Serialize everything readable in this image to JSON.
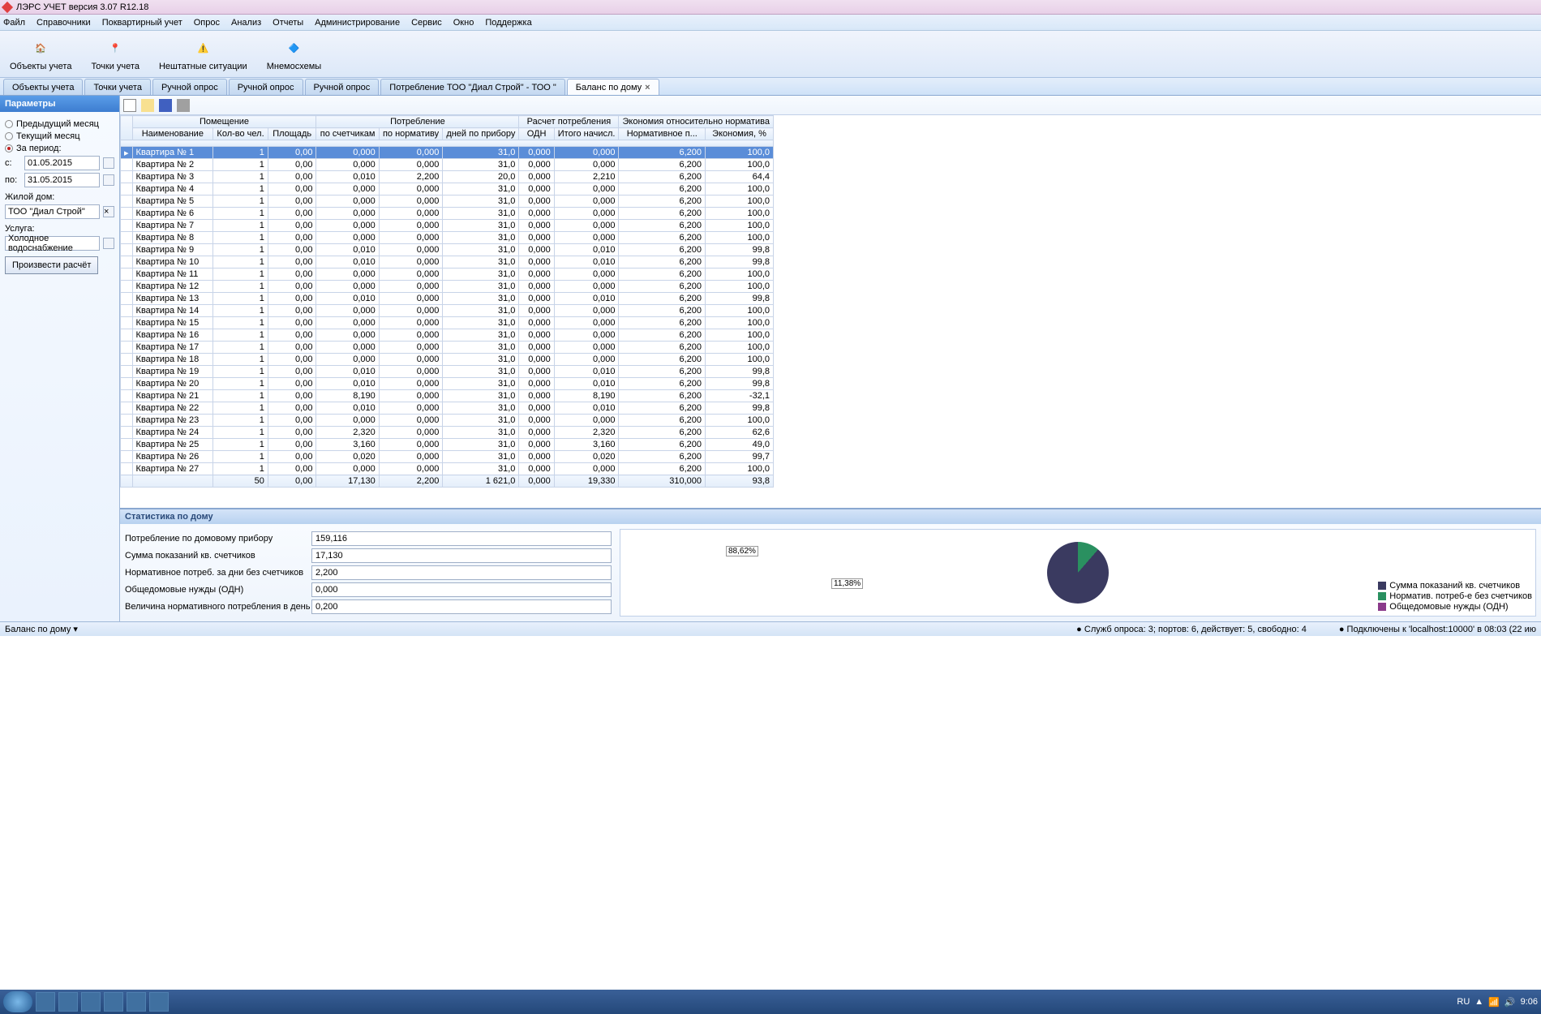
{
  "app": {
    "title": "ЛЭРС УЧЕТ версия 3.07 R12.18"
  },
  "menu": [
    "Файл",
    "Справочники",
    "Поквартирный учет",
    "Опрос",
    "Анализ",
    "Отчеты",
    "Администрирование",
    "Сервис",
    "Окно",
    "Поддержка"
  ],
  "toolbar": [
    {
      "label": "Объекты учета"
    },
    {
      "label": "Точки учета"
    },
    {
      "label": "Нештатные ситуации"
    },
    {
      "label": "Мнемосхемы"
    }
  ],
  "tabs": [
    {
      "label": "Объекты учета"
    },
    {
      "label": "Точки учета"
    },
    {
      "label": "Ручной опрос"
    },
    {
      "label": "Ручной опрос"
    },
    {
      "label": "Ручной опрос"
    },
    {
      "label": "Потребление ТОО \"Диал Строй\" - ТОО \""
    },
    {
      "label": "Баланс по дому",
      "active": true
    }
  ],
  "params": {
    "title": "Параметры",
    "radio_prev": "Предыдущий месяц",
    "radio_cur": "Текущий месяц",
    "radio_period": "За период:",
    "from_lbl": "с:",
    "to_lbl": "по:",
    "from": "01.05.2015",
    "to": "31.05.2015",
    "house_lbl": "Жилой дом:",
    "house": "ТОО \"Диал Строй\"",
    "service_lbl": "Услуга:",
    "service": "Холодное водоснабжение",
    "calc": "Произвести расчёт"
  },
  "grid": {
    "g1": [
      "Помещение",
      "Потребление",
      "Расчет потребления",
      "Экономия относительно норматива"
    ],
    "cols": [
      "Наименование",
      "Кол-во чел.",
      "Площадь",
      "по счетчикам",
      "по нормативу",
      "дней по прибору",
      "ОДН",
      "Итого начисл.",
      "Нормативное п...",
      "Экономия, %"
    ],
    "rows": [
      {
        "n": "Квартира № 1",
        "c": [
          1,
          "0,00",
          "0,000",
          "0,000",
          "31,0",
          "0,000",
          "0,000",
          "6,200",
          "100,0"
        ],
        "sel": true
      },
      {
        "n": "Квартира № 2",
        "c": [
          1,
          "0,00",
          "0,000",
          "0,000",
          "31,0",
          "0,000",
          "0,000",
          "6,200",
          "100,0"
        ]
      },
      {
        "n": "Квартира № 3",
        "c": [
          1,
          "0,00",
          "0,010",
          "2,200",
          "20,0",
          "0,000",
          "2,210",
          "6,200",
          "64,4"
        ]
      },
      {
        "n": "Квартира № 4",
        "c": [
          1,
          "0,00",
          "0,000",
          "0,000",
          "31,0",
          "0,000",
          "0,000",
          "6,200",
          "100,0"
        ]
      },
      {
        "n": "Квартира № 5",
        "c": [
          1,
          "0,00",
          "0,000",
          "0,000",
          "31,0",
          "0,000",
          "0,000",
          "6,200",
          "100,0"
        ]
      },
      {
        "n": "Квартира № 6",
        "c": [
          1,
          "0,00",
          "0,000",
          "0,000",
          "31,0",
          "0,000",
          "0,000",
          "6,200",
          "100,0"
        ]
      },
      {
        "n": "Квартира № 7",
        "c": [
          1,
          "0,00",
          "0,000",
          "0,000",
          "31,0",
          "0,000",
          "0,000",
          "6,200",
          "100,0"
        ]
      },
      {
        "n": "Квартира № 8",
        "c": [
          1,
          "0,00",
          "0,000",
          "0,000",
          "31,0",
          "0,000",
          "0,000",
          "6,200",
          "100,0"
        ]
      },
      {
        "n": "Квартира № 9",
        "c": [
          1,
          "0,00",
          "0,010",
          "0,000",
          "31,0",
          "0,000",
          "0,010",
          "6,200",
          "99,8"
        ]
      },
      {
        "n": "Квартира № 10",
        "c": [
          1,
          "0,00",
          "0,010",
          "0,000",
          "31,0",
          "0,000",
          "0,010",
          "6,200",
          "99,8"
        ]
      },
      {
        "n": "Квартира № 11",
        "c": [
          1,
          "0,00",
          "0,000",
          "0,000",
          "31,0",
          "0,000",
          "0,000",
          "6,200",
          "100,0"
        ]
      },
      {
        "n": "Квартира № 12",
        "c": [
          1,
          "0,00",
          "0,000",
          "0,000",
          "31,0",
          "0,000",
          "0,000",
          "6,200",
          "100,0"
        ]
      },
      {
        "n": "Квартира № 13",
        "c": [
          1,
          "0,00",
          "0,010",
          "0,000",
          "31,0",
          "0,000",
          "0,010",
          "6,200",
          "99,8"
        ]
      },
      {
        "n": "Квартира № 14",
        "c": [
          1,
          "0,00",
          "0,000",
          "0,000",
          "31,0",
          "0,000",
          "0,000",
          "6,200",
          "100,0"
        ]
      },
      {
        "n": "Квартира № 15",
        "c": [
          1,
          "0,00",
          "0,000",
          "0,000",
          "31,0",
          "0,000",
          "0,000",
          "6,200",
          "100,0"
        ]
      },
      {
        "n": "Квартира № 16",
        "c": [
          1,
          "0,00",
          "0,000",
          "0,000",
          "31,0",
          "0,000",
          "0,000",
          "6,200",
          "100,0"
        ]
      },
      {
        "n": "Квартира № 17",
        "c": [
          1,
          "0,00",
          "0,000",
          "0,000",
          "31,0",
          "0,000",
          "0,000",
          "6,200",
          "100,0"
        ]
      },
      {
        "n": "Квартира № 18",
        "c": [
          1,
          "0,00",
          "0,000",
          "0,000",
          "31,0",
          "0,000",
          "0,000",
          "6,200",
          "100,0"
        ]
      },
      {
        "n": "Квартира № 19",
        "c": [
          1,
          "0,00",
          "0,010",
          "0,000",
          "31,0",
          "0,000",
          "0,010",
          "6,200",
          "99,8"
        ]
      },
      {
        "n": "Квартира № 20",
        "c": [
          1,
          "0,00",
          "0,010",
          "0,000",
          "31,0",
          "0,000",
          "0,010",
          "6,200",
          "99,8"
        ]
      },
      {
        "n": "Квартира № 21",
        "c": [
          1,
          "0,00",
          "8,190",
          "0,000",
          "31,0",
          "0,000",
          "8,190",
          "6,200",
          "-32,1"
        ]
      },
      {
        "n": "Квартира № 22",
        "c": [
          1,
          "0,00",
          "0,010",
          "0,000",
          "31,0",
          "0,000",
          "0,010",
          "6,200",
          "99,8"
        ]
      },
      {
        "n": "Квартира № 23",
        "c": [
          1,
          "0,00",
          "0,000",
          "0,000",
          "31,0",
          "0,000",
          "0,000",
          "6,200",
          "100,0"
        ]
      },
      {
        "n": "Квартира № 24",
        "c": [
          1,
          "0,00",
          "2,320",
          "0,000",
          "31,0",
          "0,000",
          "2,320",
          "6,200",
          "62,6"
        ]
      },
      {
        "n": "Квартира № 25",
        "c": [
          1,
          "0,00",
          "3,160",
          "0,000",
          "31,0",
          "0,000",
          "3,160",
          "6,200",
          "49,0"
        ]
      },
      {
        "n": "Квартира № 26",
        "c": [
          1,
          "0,00",
          "0,020",
          "0,000",
          "31,0",
          "0,000",
          "0,020",
          "6,200",
          "99,7"
        ]
      },
      {
        "n": "Квартира № 27",
        "c": [
          1,
          "0,00",
          "0,000",
          "0,000",
          "31,0",
          "0,000",
          "0,000",
          "6,200",
          "100,0"
        ]
      }
    ],
    "totals": [
      "",
      "50",
      "0,00",
      "17,130",
      "2,200",
      "1 621,0",
      "0,000",
      "19,330",
      "310,000",
      "93,8"
    ]
  },
  "stats": {
    "title": "Статистика по дому",
    "rows": [
      {
        "l": "Потребление по домовому прибору",
        "v": "159,116"
      },
      {
        "l": "Сумма показаний кв. счетчиков",
        "v": "17,130"
      },
      {
        "l": "Нормативное потреб. за дни без счетчиков",
        "v": "2,200"
      },
      {
        "l": "Общедомовые нужды (ОДН)",
        "v": "0,000"
      },
      {
        "l": "Величина нормативного потребления в день",
        "v": "0,200"
      }
    ],
    "pie": {
      "a": "88,62%",
      "b": "11,38%"
    },
    "legend": [
      "Сумма показаний кв. счетчиков",
      "Норматив. потреб-е без счетчиков",
      "Общедомовые нужды (ОДН)"
    ]
  },
  "status": {
    "left": "Баланс по дому ▾",
    "mid": "Служб опроса: 3; портов: 6, действует: 5, свободно: 4",
    "right": "Подключены к 'localhost:10000' в 08:03 (22 ию"
  },
  "tray": {
    "lang": "RU",
    "time": "9:06"
  },
  "chart_data": {
    "type": "pie",
    "title": "Статистика по дому",
    "series": [
      {
        "name": "Сумма показаний кв. счетчиков",
        "value": 88.62,
        "color": "#3a3a60"
      },
      {
        "name": "Норматив. потреб-е без счетчиков",
        "value": 11.38,
        "color": "#2a9060"
      },
      {
        "name": "Общедомовые нужды (ОДН)",
        "value": 0.0,
        "color": "#8a3a8a"
      }
    ]
  }
}
